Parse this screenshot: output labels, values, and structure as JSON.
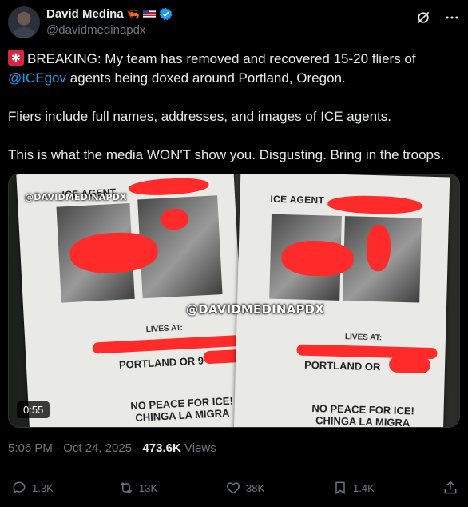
{
  "author": {
    "display_name": "David Medina",
    "emoji": "🦐",
    "handle": "@davidmedinapdx"
  },
  "tweet": {
    "line1_prefix": "BREAKING: My team has removed and recovered 15-20 fliers of",
    "mention": "@ICEgov",
    "line1_suffix": " agents being doxed around Portland, Oregon.",
    "line2": "Fliers include full names, addresses, and images of ICE agents.",
    "line3": "This is what the media WON'T show you. Disgusting. Bring in the troops."
  },
  "media": {
    "watermark": "@DAVIDMEDINAPDX",
    "duration": "0:55",
    "left_flier": {
      "title": "ICE AGENT",
      "lives": "LIVES AT:",
      "city": "PORTLAND OR 9",
      "slogan": [
        "NO PEACE FOR ICE!",
        "CHINGA LA MIGRA"
      ]
    },
    "right_flier": {
      "title": "ICE AGENT",
      "lives": "LIVES AT:",
      "city": "PORTLAND OR",
      "slogan": [
        "NO PEACE FOR ICE!",
        "CHINGA LA MIGRA"
      ]
    }
  },
  "meta": {
    "time": "5:06 PM · Oct 24, 2025 · ",
    "views_count": "473.6K",
    "views_label": " Views"
  },
  "actions": {
    "replies": "1.3K",
    "reposts": "13K",
    "likes": "38K",
    "bookmarks": "1.4K"
  },
  "icons": [
    "siren-icon",
    "verified-icon",
    "grok-icon",
    "more-icon",
    "reply-icon",
    "repost-icon",
    "like-icon",
    "bookmark-icon",
    "share-icon"
  ],
  "colors": {
    "accent": "#1d9bf0",
    "background": "#000000",
    "muted": "#71767b",
    "redaction": "#ff2a2a"
  }
}
